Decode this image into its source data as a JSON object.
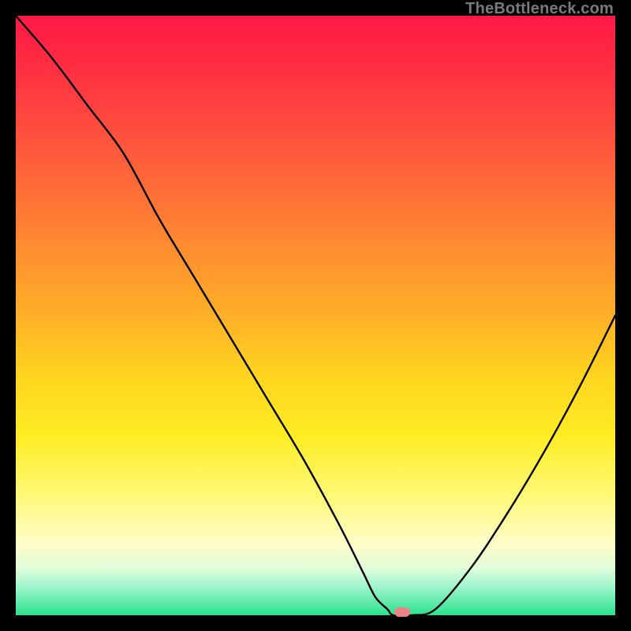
{
  "watermark": "TheBottleneck.com",
  "chart_data": {
    "type": "line",
    "title": "",
    "xlabel": "",
    "ylabel": "",
    "xlim": [
      0,
      100
    ],
    "ylim": [
      0,
      100
    ],
    "x": [
      0,
      6,
      12,
      18,
      24,
      30,
      36,
      42,
      48,
      54,
      58,
      60,
      62,
      63,
      66,
      70,
      76,
      82,
      88,
      94,
      100
    ],
    "y": [
      100,
      93,
      85,
      77,
      66,
      56,
      46,
      36,
      26,
      15,
      7,
      3,
      1,
      0,
      0,
      1,
      8,
      17,
      27,
      38,
      50
    ],
    "marker": {
      "x": 64.5,
      "y": 0
    },
    "background_gradient": {
      "type": "vertical",
      "stops": [
        {
          "pos": 0,
          "color": "#FF1846"
        },
        {
          "pos": 50,
          "color": "#FFB028"
        },
        {
          "pos": 80,
          "color": "#FFF977"
        },
        {
          "pos": 100,
          "color": "#2CE28D"
        }
      ]
    }
  }
}
